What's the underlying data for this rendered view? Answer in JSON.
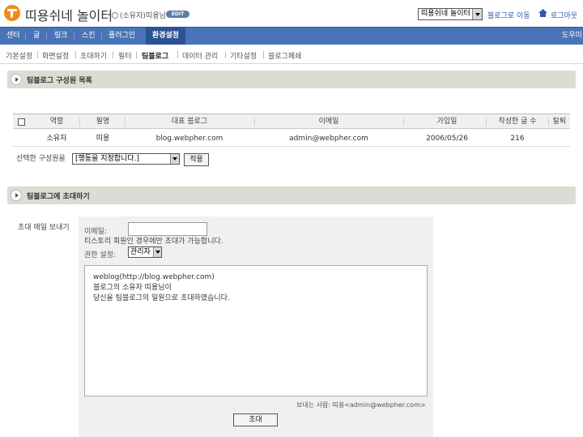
{
  "header": {
    "blog_title": "띠용쉬네 놀이터",
    "owner_label": "(소유자)",
    "username": "띠용님",
    "edit_badge": "EDIT",
    "blog_select_value": "띠용쉬네 놀이터",
    "goto_blog": "블로그로 이동",
    "logout": "로그아웃"
  },
  "main_nav": {
    "items": [
      "센터",
      "글",
      "링크",
      "스킨",
      "플러그인",
      "환경설정"
    ],
    "active": "환경설정",
    "help": "도우미"
  },
  "sub_nav": {
    "items": [
      "기본설정",
      "화면설정",
      "초대하기",
      "필터",
      "팀블로그",
      "데이터 관리",
      "기타설정",
      "블로그폐쇄"
    ],
    "active": "팀블로그"
  },
  "members_section": {
    "title": "팀블로그 구성원 목록",
    "columns": [
      "역할",
      "필명",
      "대표 블로그",
      "이메일",
      "가입일",
      "작성한 글 수",
      "탈퇴"
    ],
    "rows": [
      {
        "role": "소유자",
        "nickname": "띠용",
        "blog": "blog.webpher.com",
        "email": "admin@webpher.com",
        "joined": "2006/05/26",
        "posts": "216",
        "withdraw": ""
      }
    ],
    "bulk_label": "선택한 구성원을",
    "action_select_value": "[행동을 지정합니다.]",
    "apply_button": "적용"
  },
  "invite_section": {
    "title": "팀블로그에 초대하기",
    "row_label": "초대 메일 보내기",
    "email_label": "이메일:",
    "email_value": "",
    "note": "티스토리 회원인 경우에만 초대가 가능합니다.",
    "permission_label": "권한 설정:",
    "permission_value": "관리자",
    "message_lines": [
      "weblog(http://blog.webpher.com)",
      "블로그의 소유자 띠용님이",
      "당신을 팀블로그의 일원으로 초대하였습니다."
    ],
    "sender": "보내는 사람: 띠용<admin@webpher.com>",
    "invite_button": "초대"
  },
  "colors": {
    "nav_bg": "#4a74b8",
    "nav_active": "#2c5394",
    "section_bar": "#dcdcd4",
    "link": "#2b5aa8",
    "logo": "#f28a1b"
  }
}
